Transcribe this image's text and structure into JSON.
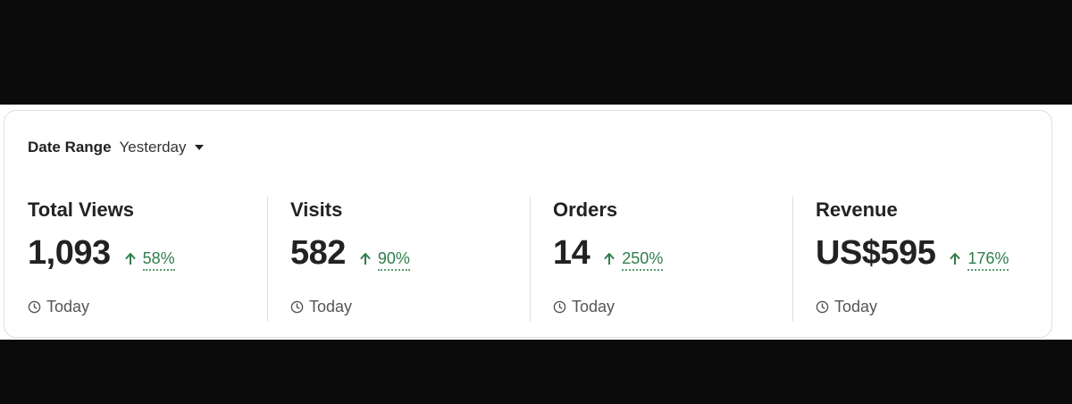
{
  "date_range": {
    "label": "Date Range",
    "value": "Yesterday",
    "icon": "caret-down-icon"
  },
  "metrics": [
    {
      "label": "Total Views",
      "value": "1,093",
      "change": "58%",
      "change_direction": "up",
      "footer": "Today"
    },
    {
      "label": "Visits",
      "value": "582",
      "change": "90%",
      "change_direction": "up",
      "footer": "Today"
    },
    {
      "label": "Orders",
      "value": "14",
      "change": "250%",
      "change_direction": "up",
      "footer": "Today"
    },
    {
      "label": "Revenue",
      "value": "US$595",
      "change": "176%",
      "change_direction": "up",
      "footer": "Today"
    }
  ],
  "colors": {
    "positive": "#2f7d4a",
    "text": "#222222",
    "muted": "#555555"
  }
}
